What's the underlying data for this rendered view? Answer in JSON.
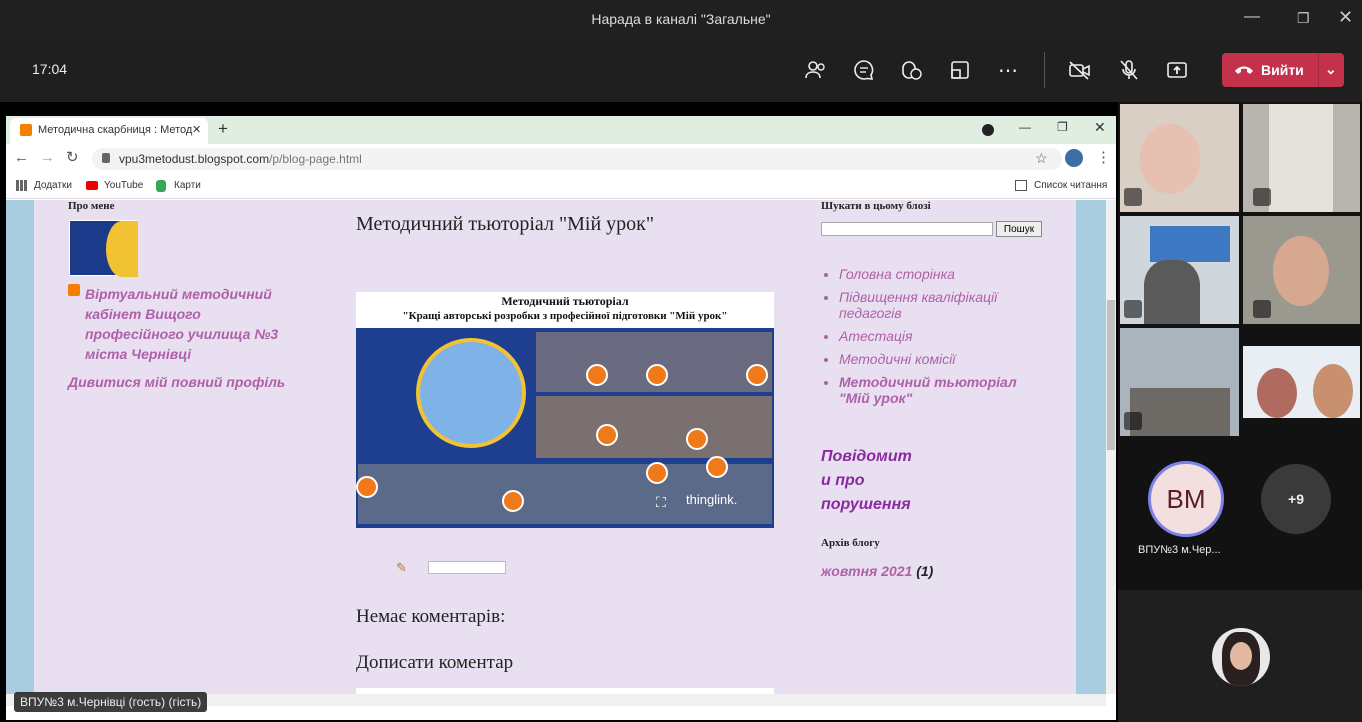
{
  "teams": {
    "window_title": "Нарада в каналі \"Загальне\"",
    "time": "17:04",
    "leave_label": "Вийти",
    "presenter_label": "ВПУ№3 м.Чернівці (гость) (гість)"
  },
  "browser": {
    "tab_title": "Методична скарбниця : Метод",
    "url_host": "vpu3metodust.blogspot.com",
    "url_path": "/p/blog-page.html",
    "bookmarks": [
      "Додатки",
      "YouTube",
      "Карти"
    ],
    "reading_list": "Список читання"
  },
  "blog": {
    "about_heading": "Про мене",
    "profile_name": "Віртуальний методичний кабінет Вищого професійного училища №3 міста Чернівці",
    "profile_link": "Дивитися мій повний профіль",
    "post_title": "Методичний тьюторіал \"Мій урок\"",
    "image_title": "Методичний тьюторіал",
    "image_subtitle": "\"Кращі авторські розробки з професійної підготовки \"Мій урок\"",
    "image_watermark": "thinglink.",
    "no_comments": "Немає коментарів:",
    "add_comment": "Дописати коментар",
    "search_heading": "Шукати в цьому блозі",
    "search_button": "Пошук",
    "nav": [
      "Головна сторінка",
      "Підвищення кваліфікації педагогів",
      "Атестація",
      "Методичні комісії",
      "Методичний тьюторіал \"Мій урок\""
    ],
    "report_text": [
      "Повідомит",
      "и про",
      "порушення"
    ],
    "archive_heading": "Архів блогу",
    "archive_item": "жовтня 2021",
    "archive_count": "(1)"
  },
  "participants": {
    "initials": "ВМ",
    "avatar_name": "ВПУ№3 м.Чер...",
    "more": "+9"
  },
  "colors": {
    "leave": "#c4314b",
    "teams_bg": "#1f1f1f",
    "blog_link": "#b060a8",
    "report": "#8a2aa0"
  }
}
